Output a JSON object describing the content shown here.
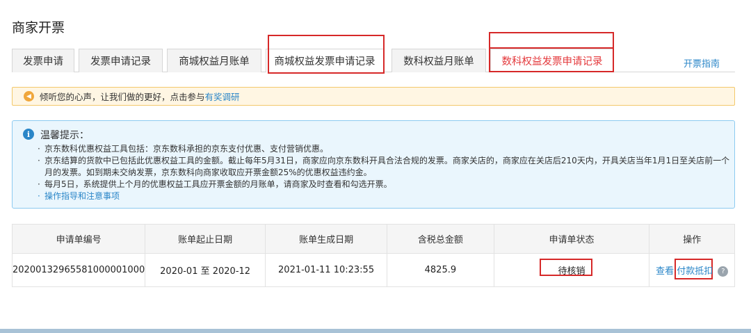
{
  "page_title": "商家开票",
  "tabs": [
    "发票申请",
    "发票申请记录",
    "商城权益月账单",
    "商城权益发票申请记录",
    "数科权益月账单",
    "数科权益发票申请记录"
  ],
  "guide_link": "开票指南",
  "notice": {
    "text": "倾听您的心声，让我们做的更好，点击参与",
    "link": "有奖调研"
  },
  "tips": {
    "title": "温馨提示：",
    "lines": [
      "京东数科优惠权益工具包括：京东数科承担的京东支付优惠、支付营销优惠。",
      "京东结算的货款中已包括此优惠权益工具的金额。截止每年5月31日，商家应向京东数科开具合法合规的发票。商家关店的，商家应在关店后210天内，开具关店当年1月1日至关店前一个月的发票。如到期未交纳发票，京东数科向商家收取应开票金额25%的优惠权益违约金。",
      "每月5日，系统提供上个月的优惠权益工具应开票金额的月账单，请商家及时查看和勾选开票。",
      "操作指导和注意事项"
    ]
  },
  "table": {
    "headers": [
      "申请单编号",
      "账单起止日期",
      "账单生成日期",
      "含税总金额",
      "申请单状态",
      "操作"
    ],
    "rows": [
      {
        "id": "20200132965581000001000",
        "period": "2020-01 至 2020-12",
        "created": "2021-01-11 10:23:55",
        "amount": "4825.9",
        "status": "待核销",
        "op_view": "查看",
        "op_pay": "付款抵扣",
        "help": "?"
      }
    ]
  },
  "colors": {
    "accent_red": "#e4393c",
    "link_blue": "#2a86c8",
    "highlight_box": "#d62828"
  }
}
